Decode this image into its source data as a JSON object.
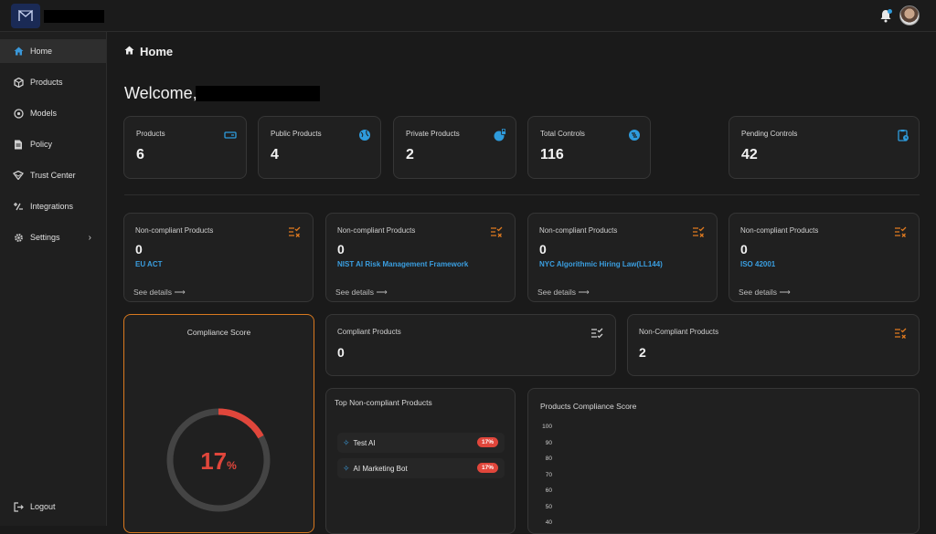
{
  "topbar": {
    "logo_icon": "brand-logo-icon",
    "bell_icon": "bell-icon",
    "avatar": "user-avatar"
  },
  "sidebar": {
    "items": [
      {
        "label": "Home",
        "icon": "home-icon"
      },
      {
        "label": "Products",
        "icon": "cube-icon"
      },
      {
        "label": "Models",
        "icon": "model-icon"
      },
      {
        "label": "Policy",
        "icon": "document-icon"
      },
      {
        "label": "Trust Center",
        "icon": "handshake-icon"
      },
      {
        "label": "Integrations",
        "icon": "integrations-icon"
      },
      {
        "label": "Settings",
        "icon": "gear-icon"
      }
    ],
    "logout": "Logout"
  },
  "page": {
    "title": "Home",
    "welcome": "Welcome,"
  },
  "stats": [
    {
      "label": "Products",
      "value": "6",
      "icon": "products-card-icon"
    },
    {
      "label": "Public Products",
      "value": "4",
      "icon": "globe-icon"
    },
    {
      "label": "Private Products",
      "value": "2",
      "icon": "lock-globe-icon"
    },
    {
      "label": "Total Controls",
      "value": "116",
      "icon": "controls-icon"
    },
    {
      "label": "Pending Controls",
      "value": "42",
      "icon": "clipboard-clock-icon"
    }
  ],
  "noncompliant": [
    {
      "label": "Non-compliant Products",
      "value": "0",
      "framework": "EU ACT"
    },
    {
      "label": "Non-compliant Products",
      "value": "0",
      "framework": "NIST AI Risk Management Framework"
    },
    {
      "label": "Non-compliant Products",
      "value": "0",
      "framework": "NYC Algorithmic Hiring Law(LL144)"
    },
    {
      "label": "Non-compliant Products",
      "value": "0",
      "framework": "ISO 42001"
    }
  ],
  "see_details": "See details",
  "compliance_score": {
    "title": "Compliance Score",
    "value": 17,
    "unit": "%",
    "color": "#e0463b"
  },
  "compliant_products": {
    "label": "Compliant Products",
    "value": "0"
  },
  "noncompliant_products": {
    "label": "Non-Compliant Products",
    "value": "2"
  },
  "top_noncompliant": {
    "title": "Top Non-compliant Products",
    "items": [
      {
        "name": "Test AI",
        "score": "17%"
      },
      {
        "name": "AI Marketing Bot",
        "score": "17%"
      }
    ]
  },
  "chart_data": {
    "type": "bar",
    "title": "Products Compliance Score",
    "categories": [],
    "values": [],
    "y_ticks": [
      "100",
      "90",
      "80",
      "70",
      "60",
      "50",
      "40"
    ],
    "ylim": [
      40,
      100
    ]
  }
}
